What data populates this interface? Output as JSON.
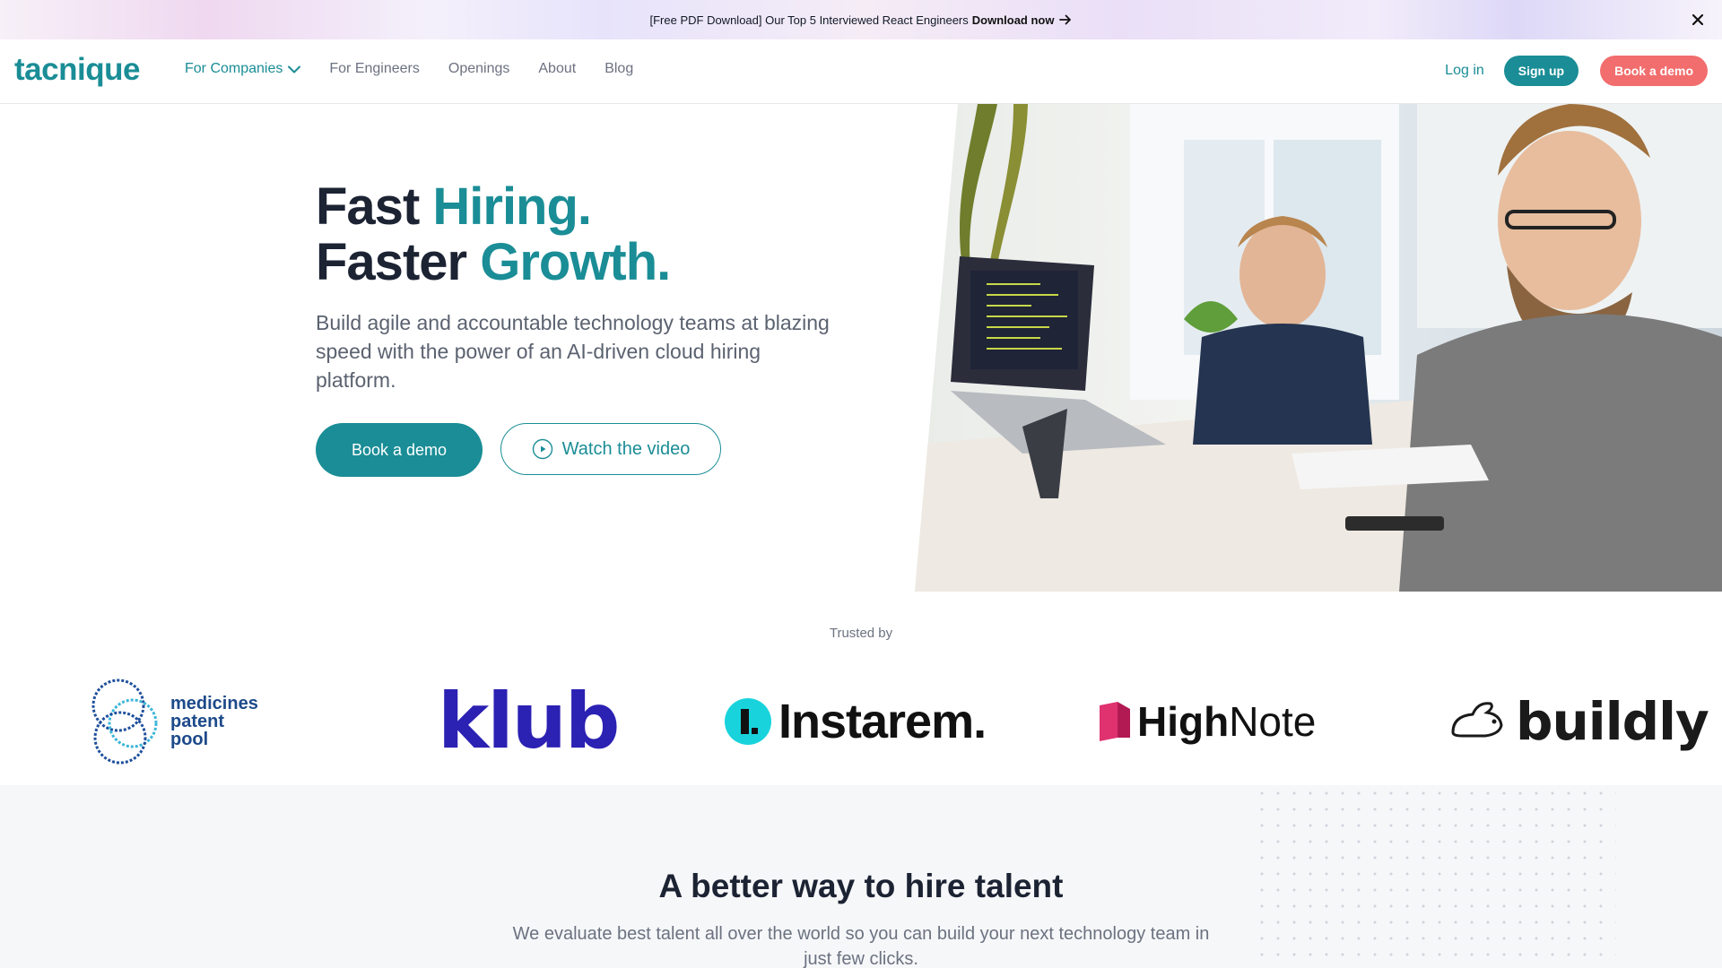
{
  "announcement": {
    "text": "[Free PDF Download] Our Top 5 Interviewed React Engineers",
    "link": "Download now"
  },
  "nav": {
    "logo": "tacnique",
    "items": [
      {
        "label": "For Companies"
      },
      {
        "label": "For Engineers"
      },
      {
        "label": "Openings"
      },
      {
        "label": "About"
      },
      {
        "label": "Blog"
      }
    ],
    "login": "Log in",
    "signup": "Sign up",
    "book_demo": "Book a demo"
  },
  "hero": {
    "line1_plain": "Fast ",
    "line1_accent": "Hiring.",
    "line2_plain": "Faster ",
    "line2_accent": "Growth.",
    "subtitle": "Build agile and accountable technology teams at blazing speed with the power of an AI-driven cloud hiring platform.",
    "book_demo": "Book a demo",
    "watch_video": "Watch the video"
  },
  "trusted": {
    "label": "Trusted by",
    "logos": {
      "mpp_line1": "medicines",
      "mpp_line2": "patent",
      "mpp_line3": "pool",
      "klub": "klub",
      "instarem": "Instarem.",
      "instarem_mark": "I.",
      "highnote_bold": "High",
      "highnote_light": "Note",
      "buildly": "buildly"
    }
  },
  "section": {
    "title": "A better way to hire talent",
    "subtitle": "We evaluate best talent all over the world so you can build your next technology team in just few clicks."
  },
  "colors": {
    "brand": "#1a8d96",
    "coral": "#f26d6d",
    "heading": "#1c2333"
  }
}
